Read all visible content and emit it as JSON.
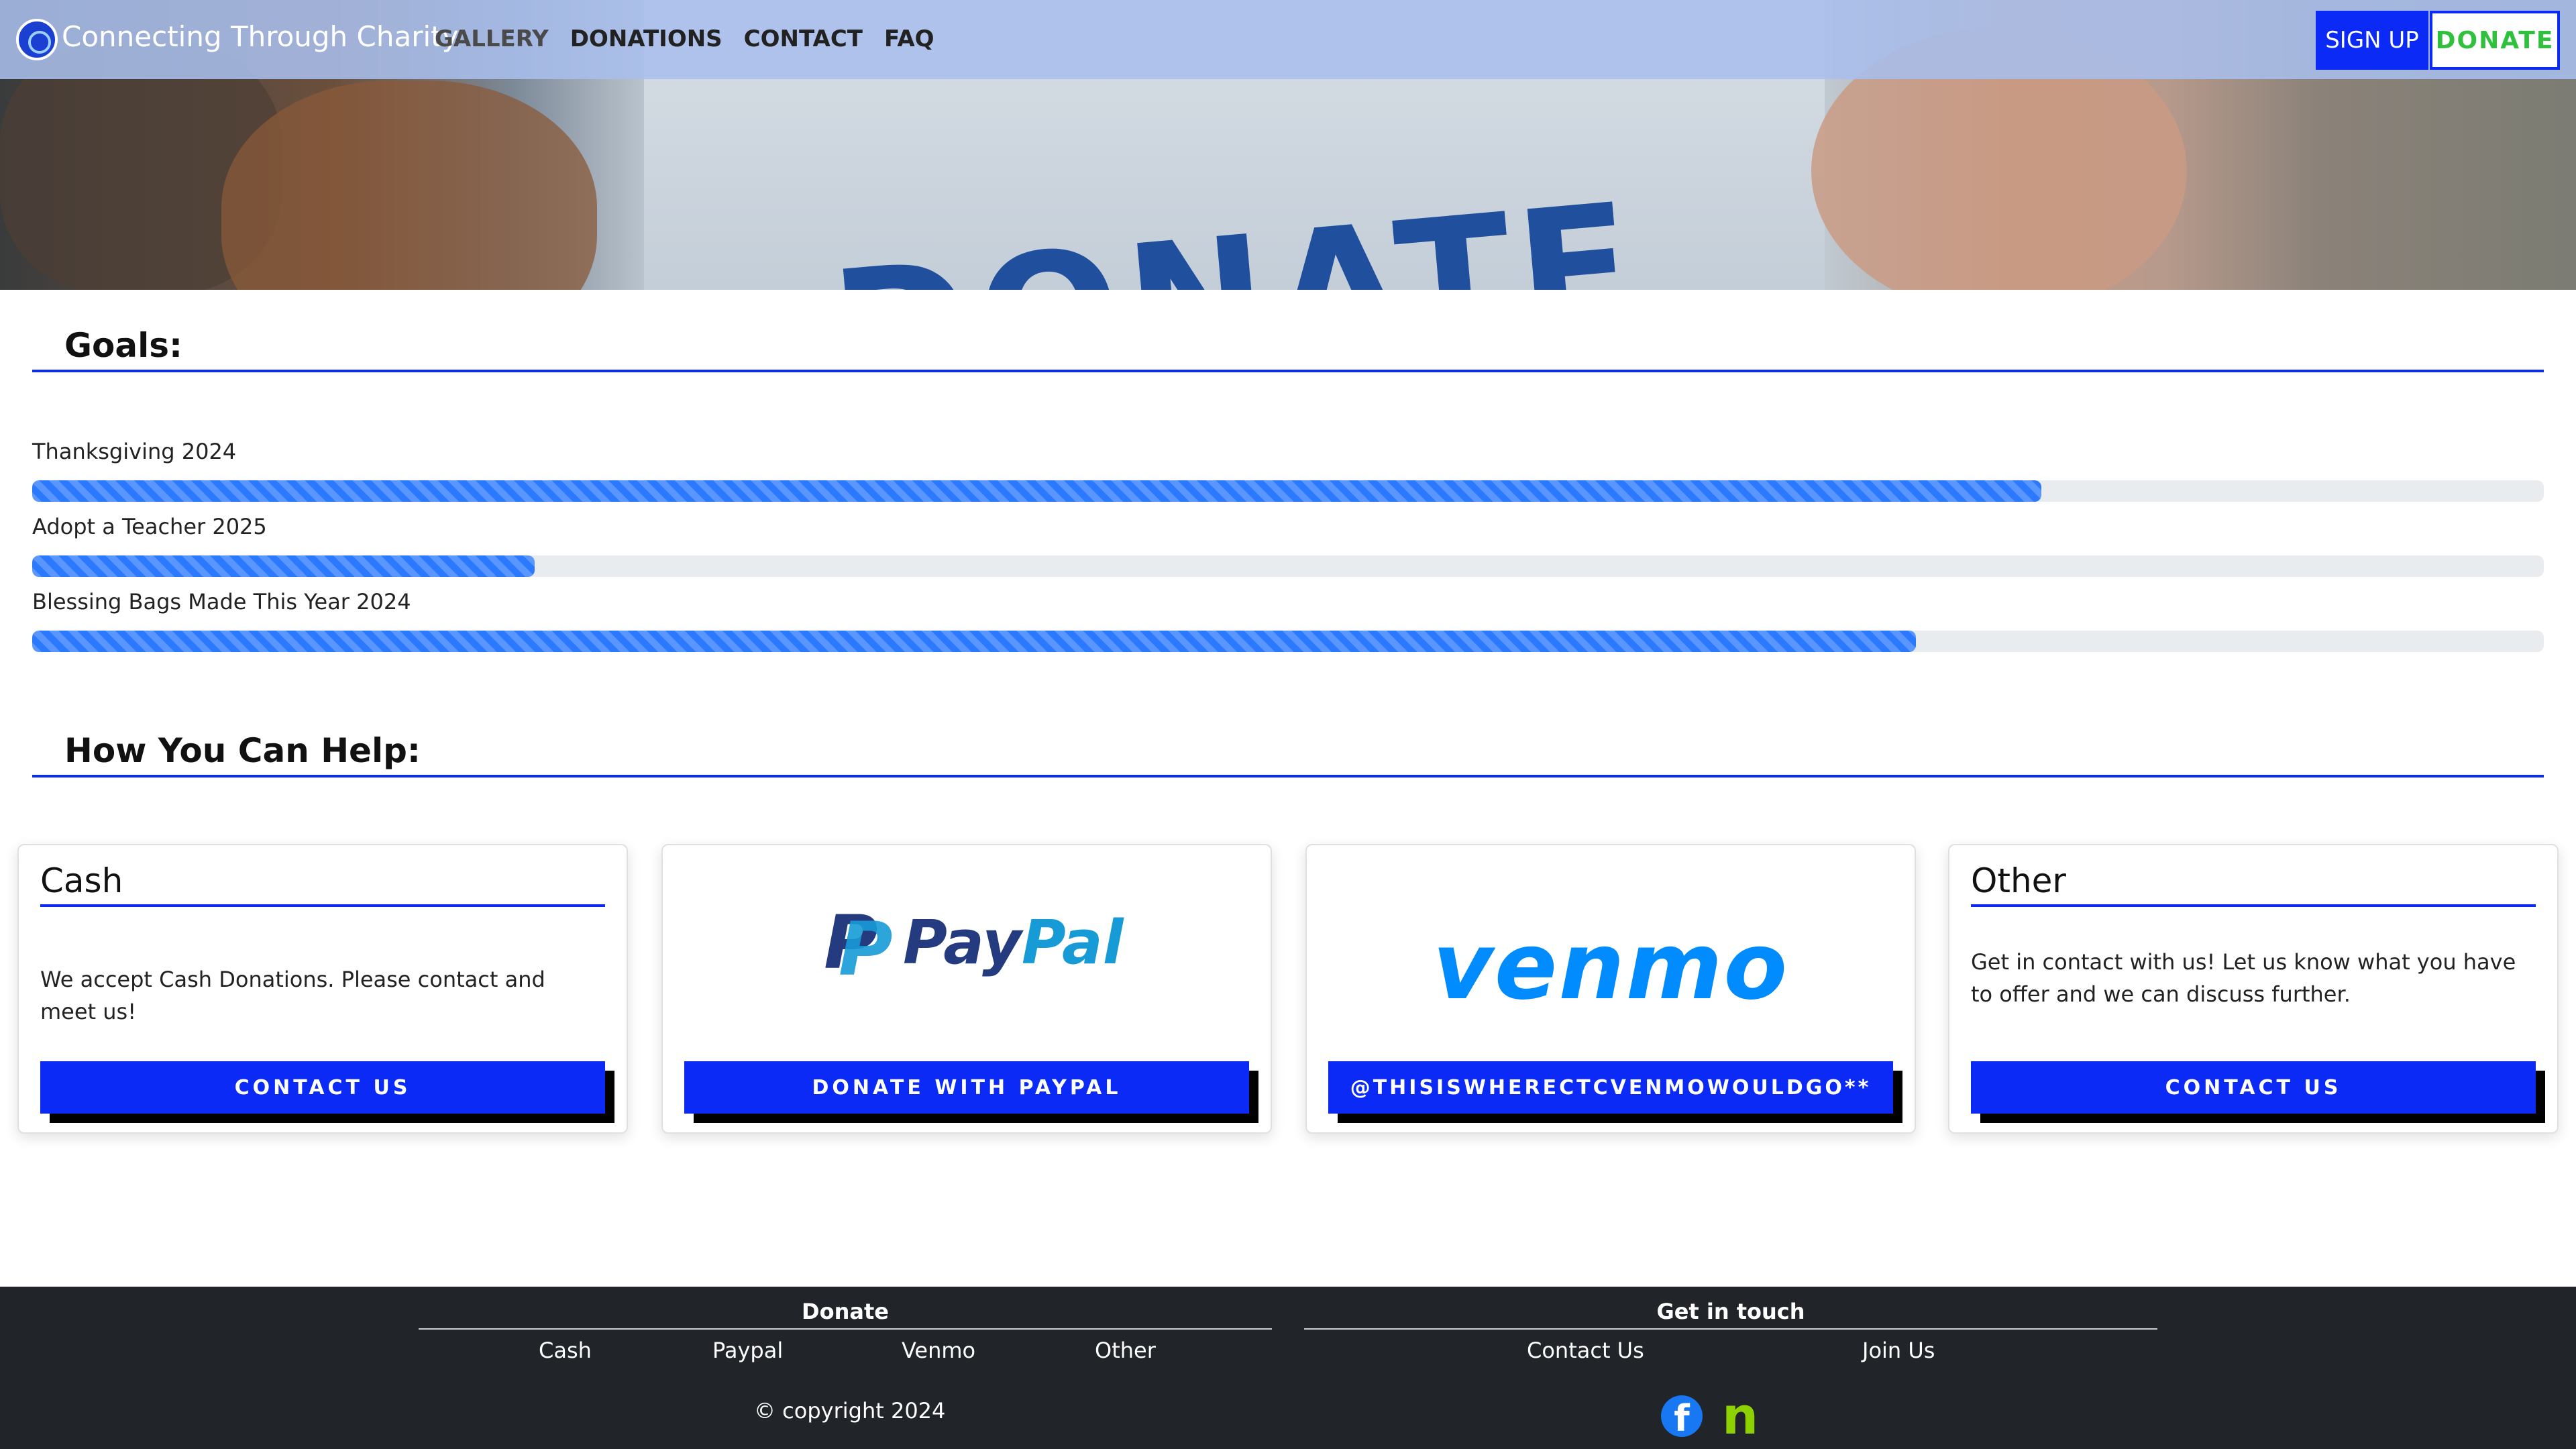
{
  "navbar": {
    "brand": "Connecting Through Charity",
    "links": [
      "GALLERY",
      "DONATIONS",
      "CONTACT",
      "FAQ"
    ],
    "signup_label": "SIGN UP",
    "donate_label": "DONATE"
  },
  "hero": {
    "sign_text": "DONATE"
  },
  "goals": {
    "title": "Goals:",
    "items": [
      {
        "label": "Thanksgiving 2024",
        "progress": 0.8
      },
      {
        "label": "Adopt a Teacher 2025",
        "progress": 0.2
      },
      {
        "label": "Blessing Bags Made This Year 2024",
        "progress": 0.75
      }
    ]
  },
  "help": {
    "title": "How You Can Help:",
    "cards": [
      {
        "title": "Cash",
        "text": "We accept Cash Donations. Please contact and meet us!",
        "button": "CONTACT US"
      },
      {
        "logo_part1": "Pay",
        "logo_part2": "Pal",
        "button": "DONATE WITH PAYPAL"
      },
      {
        "logo": "venmo",
        "button": "@THISISWHERECTCVENMOWOULDGO**"
      },
      {
        "title": "Other",
        "text": "Get in contact with us! Let us know what you have to offer and we can discuss further.",
        "button": "CONTACT US"
      }
    ]
  },
  "footer": {
    "donate_heading": "Donate",
    "donate_links": [
      "Cash",
      "Paypal",
      "Venmo",
      "Other"
    ],
    "contact_heading": "Get in touch",
    "contact_links": [
      "Contact Us",
      "Join Us"
    ],
    "copyright": "© copyright 2024"
  },
  "colors": {
    "accent_blue": "#0b2af5",
    "progress_blue": "#2b79ff",
    "donate_green": "#2fc13d",
    "footer_bg": "#212529"
  },
  "icons": {
    "logo": "charity-globe-icon",
    "facebook": "facebook-icon",
    "nextdoor": "nextdoor-icon"
  }
}
